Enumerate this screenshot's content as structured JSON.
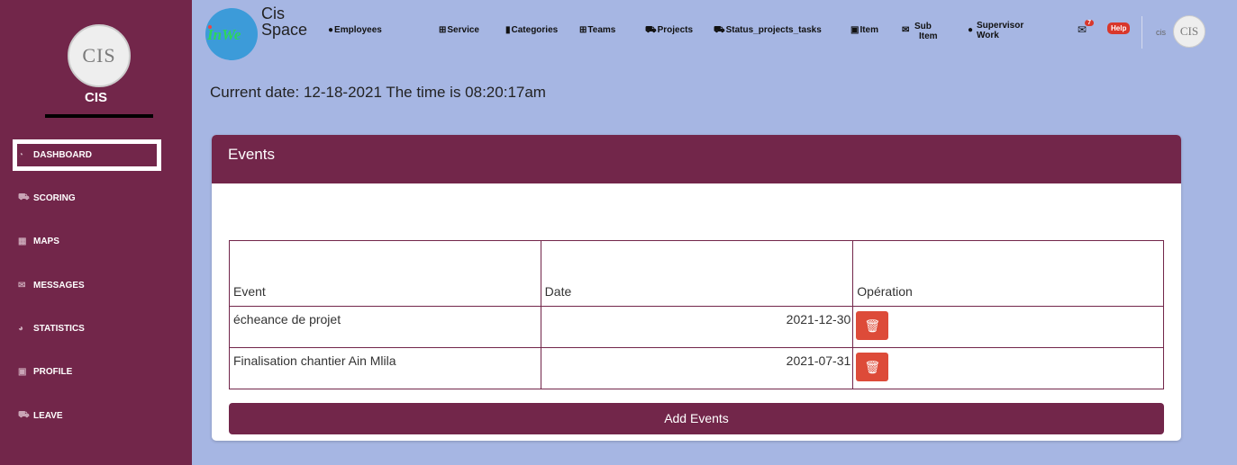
{
  "sidebar": {
    "logo_text": "CIS",
    "brand": "CIS",
    "items": [
      {
        "label": "DASHBOARD",
        "icon": "gauge-icon",
        "glyph": "◔"
      },
      {
        "label": "SCORING",
        "icon": "truck-icon",
        "glyph": "⛟"
      },
      {
        "label": "MAPS",
        "icon": "map-icon",
        "glyph": "▦"
      },
      {
        "label": "MESSAGES",
        "icon": "envelope-icon",
        "glyph": "✉"
      },
      {
        "label": "STATISTICS",
        "icon": "pie-chart-icon",
        "glyph": "◕"
      },
      {
        "label": "PROFILE",
        "icon": "id-card-icon",
        "glyph": "▣"
      },
      {
        "label": "LEAVE",
        "icon": "truck-icon",
        "glyph": "⛟"
      }
    ]
  },
  "topbar": {
    "logo_text": "InWe",
    "title_line1": "Cis",
    "title_line2": "Space",
    "menu": [
      {
        "label": "Employees",
        "icon": "user-icon",
        "glyph": "👤"
      },
      {
        "label": "Service",
        "icon": "table-icon",
        "glyph": "⊞"
      },
      {
        "label": "Categories",
        "icon": "folder-icon",
        "glyph": "▮"
      },
      {
        "label": "Teams",
        "icon": "table-icon",
        "glyph": "⊞"
      },
      {
        "label": "Projects",
        "icon": "truck-icon",
        "glyph": "⛟"
      },
      {
        "label": "Status_projects_tasks",
        "icon": "truck-icon",
        "glyph": "⛟"
      },
      {
        "label": "Item",
        "icon": "window-icon",
        "glyph": "▣"
      }
    ],
    "sub_item": {
      "line1": "Sub",
      "line2": "Item"
    },
    "supervisor": {
      "line1": "Supervisor",
      "line2": "Work"
    },
    "messages_badge": "7",
    "help_label": "Help",
    "user_name": "cis",
    "avatar_text": "CIS"
  },
  "current_date_text": "Current date: 12-18-2021 The time is 08:20:17am",
  "events_card": {
    "title": "Events",
    "columns": [
      "Event",
      "Date",
      "Opération"
    ],
    "rows": [
      {
        "event": "écheance de projet",
        "date": "2021-12-30"
      },
      {
        "event": "Finalisation chantier Ain Mlila",
        "date": "2021-07-31"
      }
    ],
    "add_button": "Add Events"
  },
  "colors": {
    "primary": "#72264a",
    "background": "#a6b6e3",
    "danger": "#dd4b39"
  }
}
